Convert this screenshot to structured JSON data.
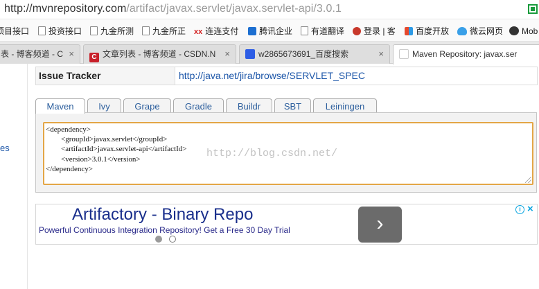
{
  "address_bar": {
    "url_host": "http://mvnrepository.com",
    "url_path": "/artifact/javax.servlet/javax.servlet-api/3.0.1"
  },
  "bookmarks": [
    {
      "label": "项目接口",
      "icon": "page-icon"
    },
    {
      "label": "投资接口",
      "icon": "page-icon"
    },
    {
      "label": "九金所测",
      "icon": "page-icon"
    },
    {
      "label": "九金所正",
      "icon": "page-icon"
    },
    {
      "label": "连连支付",
      "icon": "xx-logo-icon"
    },
    {
      "label": "腾讯企业",
      "icon": "tencent-icon"
    },
    {
      "label": "有道翻译",
      "icon": "page-icon"
    },
    {
      "label": "登录 | 客",
      "icon": "weibo-icon"
    },
    {
      "label": "百度开放",
      "icon": "grid-icon"
    },
    {
      "label": "微云网页",
      "icon": "cloud-icon"
    },
    {
      "label": "Mob",
      "icon": "panda-icon"
    }
  ],
  "tabs": [
    {
      "label": "表 - 博客频道 - C",
      "icon": "page-icon",
      "active": false
    },
    {
      "label": "文章列表 - 博客频道 - CSDN.N",
      "icon": "csdn-icon",
      "active": false
    },
    {
      "label": "w2865673691_百度搜索",
      "icon": "baidu-paw-icon",
      "active": false
    },
    {
      "label": "Maven Repository: javax.ser",
      "icon": "maven-icon",
      "active": true
    }
  ],
  "tab_close": "×",
  "csdn_letter": "C",
  "left_fragment": "es",
  "issue_tracker": {
    "label": "Issue Tracker",
    "url": "http://java.net/jira/browse/SERVLET_SPEC"
  },
  "build_tabs": [
    "Maven",
    "Ivy",
    "Grape",
    "Gradle",
    "Buildr",
    "SBT",
    "Leiningen"
  ],
  "active_build_tab": "Maven",
  "dependency_snippet": "<dependency>\n\t<groupId>javax.servlet</groupId>\n\t<artifactId>javax.servlet-api</artifactId>\n\t<version>3.0.1</version>\n</dependency>",
  "watermark": "http://blog.csdn.net/",
  "ad": {
    "title": "Artifactory - Binary Repo",
    "subtitle": "Powerful Continuous Integration Repository! Get a Free 30 Day Trial",
    "arrow": "›",
    "info": "i",
    "close": "×",
    "slide_count": 2,
    "active_slide": 1
  }
}
